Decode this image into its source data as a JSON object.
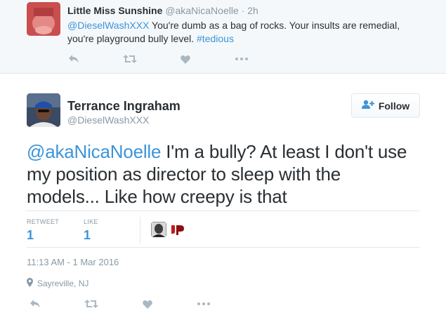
{
  "reply_tweet": {
    "author_name": "Little Miss Sunshine",
    "author_handle": "@akaNicaNoelle",
    "separator": "·",
    "time": "2h",
    "mention": "@DieselWashXXX",
    "text_line1": "You're dumb as a bag of rocks. Your insults are remedial,",
    "text_line2": "you're playground bully level.",
    "hashtag": "#tedious",
    "actions": [
      "reply-icon",
      "retweet-icon",
      "like-icon",
      "more-icon"
    ]
  },
  "main_tweet": {
    "author_name": "Terrance Ingraham",
    "author_handle": "@DieselWashXXX",
    "follow_label": "Follow",
    "mention": "@akaNicaNoelle",
    "text_line1_rest": " I'm a bully? At least I don't use",
    "text_line2": "my position as director to sleep with the",
    "text_line3": "models... Like how creepy is that",
    "stats": {
      "retweet_label": "RETWEET",
      "retweet_count": "1",
      "like_label": "LIKE",
      "like_count": "1"
    },
    "timestamp": "11:13 AM - 1 Mar 2016",
    "location": "Sayreville, NJ",
    "actions": [
      "reply-icon",
      "retweet-icon",
      "like-icon",
      "more-icon"
    ]
  },
  "colors": {
    "link": "#3b94d9",
    "muted": "#8899a6",
    "text": "#292f33",
    "icon": "#aab8c2"
  }
}
